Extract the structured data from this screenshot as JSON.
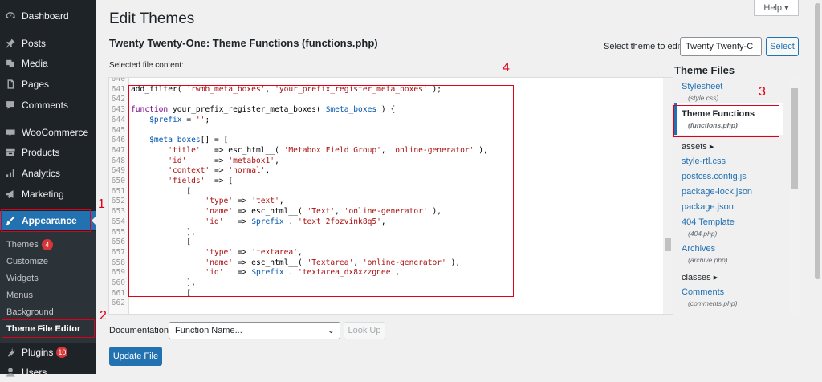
{
  "sidebar": {
    "items": [
      {
        "label": "Dashboard",
        "icon": "dashboard-icon"
      },
      {
        "label": "Posts",
        "icon": "pin-icon"
      },
      {
        "label": "Media",
        "icon": "media-icon"
      },
      {
        "label": "Pages",
        "icon": "page-icon"
      },
      {
        "label": "Comments",
        "icon": "comment-icon"
      },
      {
        "label": "WooCommerce",
        "icon": "woocommerce-icon"
      },
      {
        "label": "Products",
        "icon": "archive-icon"
      },
      {
        "label": "Analytics",
        "icon": "bar-chart-icon"
      },
      {
        "label": "Marketing",
        "icon": "megaphone-icon"
      },
      {
        "label": "Appearance",
        "icon": "paintbrush-icon"
      },
      {
        "label": "Plugins",
        "icon": "plug-icon",
        "badge": "10"
      },
      {
        "label": "Users",
        "icon": "user-icon"
      }
    ],
    "submenu": [
      {
        "label": "Themes",
        "badge": "4"
      },
      {
        "label": "Customize"
      },
      {
        "label": "Widgets"
      },
      {
        "label": "Menus"
      },
      {
        "label": "Background"
      },
      {
        "label": "Theme File Editor"
      }
    ]
  },
  "annotations": [
    "1",
    "2",
    "3",
    "4"
  ],
  "header": {
    "title": "Edit Themes",
    "help_label": "Help ▾",
    "file_heading": "Twenty Twenty-One: Theme Functions (functions.php)",
    "select_theme_label": "Select theme to edit:",
    "selected_theme": "Twenty Twenty-C",
    "select_button": "Select",
    "selected_content_label": "Selected file content:"
  },
  "editor": {
    "lines": [
      {
        "n": "640",
        "segs": []
      },
      {
        "n": "641",
        "segs": [
          {
            "t": "add_filter( ",
            "c": "f"
          },
          {
            "t": "'rwmb_meta_boxes'",
            "c": "s"
          },
          {
            "t": ", ",
            "c": "f"
          },
          {
            "t": "'your_prefix_register_meta_boxes'",
            "c": "s"
          },
          {
            "t": " );",
            "c": "f"
          }
        ]
      },
      {
        "n": "642",
        "segs": []
      },
      {
        "n": "643",
        "segs": [
          {
            "t": "function",
            "c": "k"
          },
          {
            "t": " your_prefix_register_meta_boxes( ",
            "c": "f"
          },
          {
            "t": "$meta_boxes",
            "c": "v"
          },
          {
            "t": " ) {",
            "c": "f"
          }
        ]
      },
      {
        "n": "644",
        "segs": [
          {
            "t": "    ",
            "c": "f"
          },
          {
            "t": "$prefix",
            "c": "v"
          },
          {
            "t": " = ",
            "c": "f"
          },
          {
            "t": "''",
            "c": "s"
          },
          {
            "t": ";",
            "c": "f"
          }
        ]
      },
      {
        "n": "645",
        "segs": []
      },
      {
        "n": "646",
        "segs": [
          {
            "t": "    ",
            "c": "f"
          },
          {
            "t": "$meta_boxes",
            "c": "v"
          },
          {
            "t": "[] = [",
            "c": "f"
          }
        ]
      },
      {
        "n": "647",
        "segs": [
          {
            "t": "        ",
            "c": "f"
          },
          {
            "t": "'title'",
            "c": "s"
          },
          {
            "t": "   => esc_html__( ",
            "c": "f"
          },
          {
            "t": "'Metabox Field Group'",
            "c": "s"
          },
          {
            "t": ", ",
            "c": "f"
          },
          {
            "t": "'online-generator'",
            "c": "s"
          },
          {
            "t": " ),",
            "c": "f"
          }
        ]
      },
      {
        "n": "648",
        "segs": [
          {
            "t": "        ",
            "c": "f"
          },
          {
            "t": "'id'",
            "c": "s"
          },
          {
            "t": "      => ",
            "c": "f"
          },
          {
            "t": "'metabox1'",
            "c": "s"
          },
          {
            "t": ",",
            "c": "f"
          }
        ]
      },
      {
        "n": "649",
        "segs": [
          {
            "t": "        ",
            "c": "f"
          },
          {
            "t": "'context'",
            "c": "s"
          },
          {
            "t": " => ",
            "c": "f"
          },
          {
            "t": "'normal'",
            "c": "s"
          },
          {
            "t": ",",
            "c": "f"
          }
        ]
      },
      {
        "n": "650",
        "segs": [
          {
            "t": "        ",
            "c": "f"
          },
          {
            "t": "'fields'",
            "c": "s"
          },
          {
            "t": "  => [",
            "c": "f"
          }
        ]
      },
      {
        "n": "651",
        "segs": [
          {
            "t": "            [",
            "c": "f"
          }
        ]
      },
      {
        "n": "652",
        "segs": [
          {
            "t": "                ",
            "c": "f"
          },
          {
            "t": "'type'",
            "c": "s"
          },
          {
            "t": " => ",
            "c": "f"
          },
          {
            "t": "'text'",
            "c": "s"
          },
          {
            "t": ",",
            "c": "f"
          }
        ]
      },
      {
        "n": "653",
        "segs": [
          {
            "t": "                ",
            "c": "f"
          },
          {
            "t": "'name'",
            "c": "s"
          },
          {
            "t": " => esc_html__( ",
            "c": "f"
          },
          {
            "t": "'Text'",
            "c": "s"
          },
          {
            "t": ", ",
            "c": "f"
          },
          {
            "t": "'online-generator'",
            "c": "s"
          },
          {
            "t": " ),",
            "c": "f"
          }
        ]
      },
      {
        "n": "654",
        "segs": [
          {
            "t": "                ",
            "c": "f"
          },
          {
            "t": "'id'",
            "c": "s"
          },
          {
            "t": "   => ",
            "c": "f"
          },
          {
            "t": "$prefix",
            "c": "v"
          },
          {
            "t": " . ",
            "c": "f"
          },
          {
            "t": "'text_2fozvink8q5'",
            "c": "s"
          },
          {
            "t": ",",
            "c": "f"
          }
        ]
      },
      {
        "n": "655",
        "segs": [
          {
            "t": "            ],",
            "c": "f"
          }
        ]
      },
      {
        "n": "656",
        "segs": [
          {
            "t": "            [",
            "c": "f"
          }
        ]
      },
      {
        "n": "657",
        "segs": [
          {
            "t": "                ",
            "c": "f"
          },
          {
            "t": "'type'",
            "c": "s"
          },
          {
            "t": " => ",
            "c": "f"
          },
          {
            "t": "'textarea'",
            "c": "s"
          },
          {
            "t": ",",
            "c": "f"
          }
        ]
      },
      {
        "n": "658",
        "segs": [
          {
            "t": "                ",
            "c": "f"
          },
          {
            "t": "'name'",
            "c": "s"
          },
          {
            "t": " => esc_html__( ",
            "c": "f"
          },
          {
            "t": "'Textarea'",
            "c": "s"
          },
          {
            "t": ", ",
            "c": "f"
          },
          {
            "t": "'online-generator'",
            "c": "s"
          },
          {
            "t": " ),",
            "c": "f"
          }
        ]
      },
      {
        "n": "659",
        "segs": [
          {
            "t": "                ",
            "c": "f"
          },
          {
            "t": "'id'",
            "c": "s"
          },
          {
            "t": "   => ",
            "c": "f"
          },
          {
            "t": "$prefix",
            "c": "v"
          },
          {
            "t": " . ",
            "c": "f"
          },
          {
            "t": "'textarea_dx8xzzgnee'",
            "c": "s"
          },
          {
            "t": ",",
            "c": "f"
          }
        ]
      },
      {
        "n": "660",
        "segs": [
          {
            "t": "            ],",
            "c": "f"
          }
        ]
      },
      {
        "n": "661",
        "segs": [
          {
            "t": "            [",
            "c": "f"
          }
        ]
      },
      {
        "n": "662",
        "segs": []
      }
    ]
  },
  "theme_files": {
    "title": "Theme Files",
    "files": [
      {
        "label": "Stylesheet",
        "desc": "(style.css)"
      },
      {
        "label": "Theme Functions",
        "desc": "(functions.php)",
        "current": true
      },
      {
        "label": "assets ▸",
        "dir": true
      },
      {
        "label": "style-rtl.css"
      },
      {
        "label": "postcss.config.js"
      },
      {
        "label": "package-lock.json"
      },
      {
        "label": "package.json"
      },
      {
        "label": "404 Template",
        "desc": "(404.php)"
      },
      {
        "label": "Archives",
        "desc": "(archive.php)"
      },
      {
        "label": "classes ▸",
        "dir": true
      },
      {
        "label": "Comments",
        "desc": "(comments.php)"
      }
    ]
  },
  "footer": {
    "documentation_label": "Documentation:",
    "function_placeholder": "Function Name...",
    "lookup_label": "Look Up",
    "update_label": "Update File"
  },
  "colors": {
    "accent": "#2271b1",
    "annotation": "#e0001a",
    "sidebar_bg": "#1d2327"
  }
}
